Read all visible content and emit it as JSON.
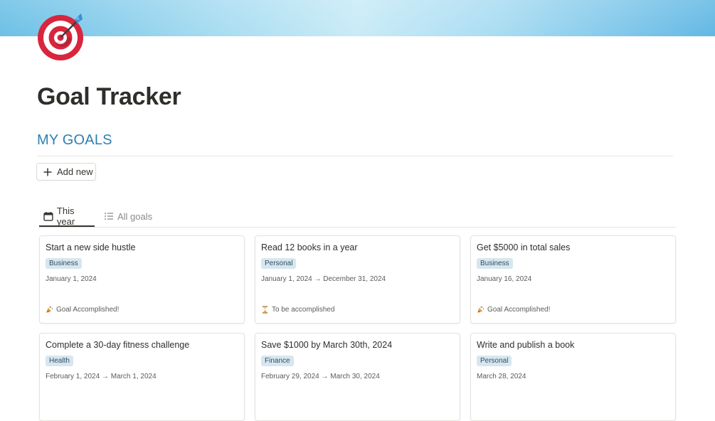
{
  "page": {
    "title": "Goal Tracker",
    "icon": "target-dart-icon"
  },
  "section": {
    "heading": "MY GOALS"
  },
  "toolbar": {
    "add_new_label": "Add new"
  },
  "tabs": [
    {
      "label": "This year",
      "icon": "calendar-icon",
      "active": true
    },
    {
      "label": "All goals",
      "icon": "list-icon",
      "active": false
    }
  ],
  "goals": [
    {
      "title": "Start a new side hustle",
      "tag": "Business",
      "date": "January 1, 2024",
      "status": "Goal Accomplished!",
      "status_icon": "party-popper-icon"
    },
    {
      "title": "Read 12 books in a year",
      "tag": "Personal",
      "date": "January 1, 2024 → December 31, 2024",
      "status": "To be accomplished",
      "status_icon": "hourglass-icon"
    },
    {
      "title": "Get $5000 in total sales",
      "tag": "Business",
      "date": "January 16, 2024",
      "status": "Goal Accomplished!",
      "status_icon": "party-popper-icon"
    },
    {
      "title": "Complete a 30-day fitness challenge",
      "tag": "Health",
      "date": "February 1, 2024 → March 1, 2024",
      "status": "",
      "status_icon": ""
    },
    {
      "title": "Save $1000 by March 30th, 2024",
      "tag": "Finance",
      "date": "February 29, 2024 → March 30, 2024",
      "status": "",
      "status_icon": ""
    },
    {
      "title": "Write and publish a book",
      "tag": "Personal",
      "date": "March 28, 2024",
      "status": "",
      "status_icon": ""
    }
  ],
  "colors": {
    "heading_blue": "#2f7fb0",
    "tag_bg": "#d7e6ef",
    "cover_gradient_start": "#6cc0e6",
    "cover_gradient_mid": "#c9ebf7",
    "target_red": "#d7263d"
  }
}
